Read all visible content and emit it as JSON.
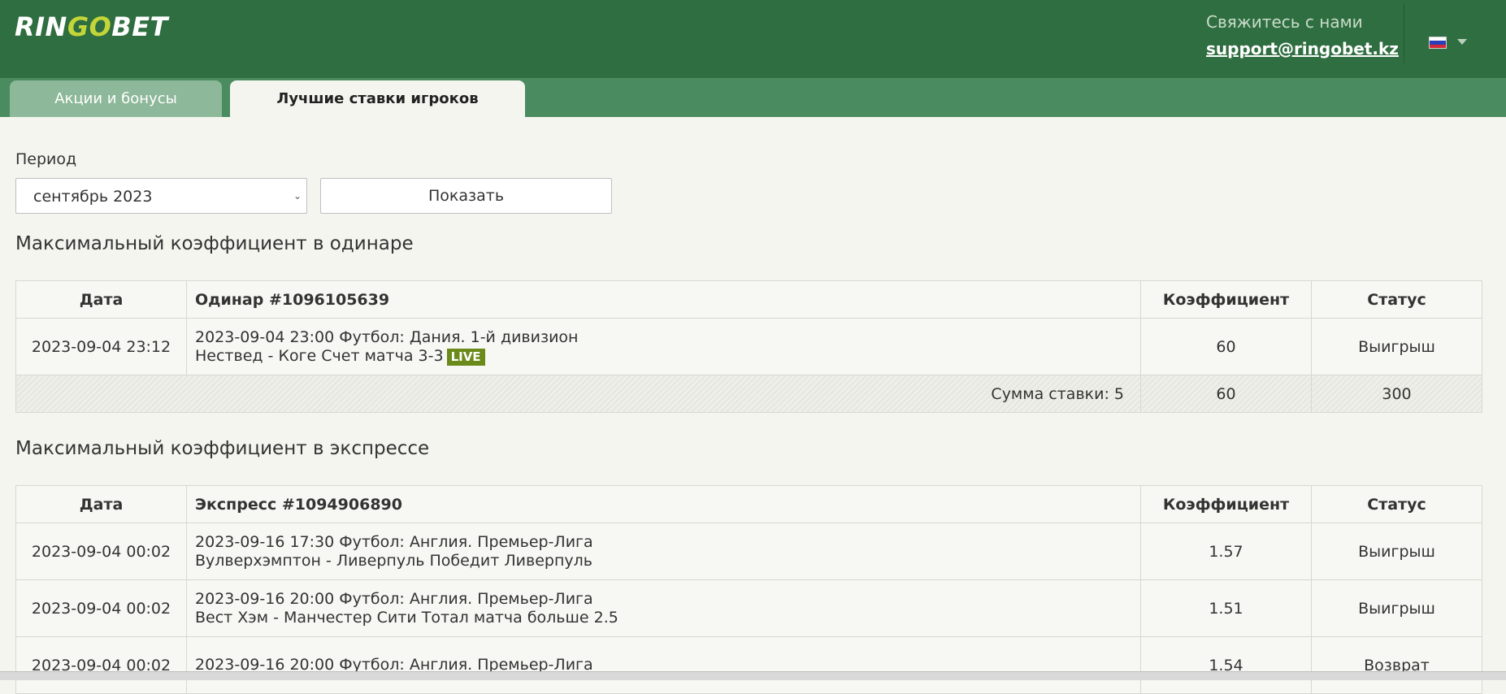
{
  "header": {
    "logo": {
      "part1": "RIN",
      "part2": "GO",
      "part3": "BET"
    },
    "contact_title": "Свяжитесь с нами",
    "contact_email": "support@ringobet.kz",
    "language_flag": "russia-flag-icon"
  },
  "tabs": [
    {
      "label": "Акции и бонусы",
      "active": false
    },
    {
      "label": "Лучшие ставки игроков",
      "active": true
    }
  ],
  "filter": {
    "period_label": "Период",
    "period_value": "сентябрь 2023",
    "show_button": "Показать"
  },
  "single": {
    "title": "Максимальный коэффициент в одинаре",
    "headers": {
      "date": "Дата",
      "bet": "Одинар #1096105639",
      "coef": "Коэффициент",
      "status": "Статус"
    },
    "rows": [
      {
        "date": "2023-09-04 23:12",
        "line1": "2023-09-04 23:00 Футбол: Дания. 1-й дивизион",
        "line2": "Нествед - Коге Счет матча 3-3",
        "badge": "LIVE",
        "coef": "60",
        "status": "Выигрыш"
      }
    ],
    "summary": {
      "label": "Сумма ставки: 5",
      "coef": "60",
      "payout": "300"
    }
  },
  "express": {
    "title": "Максимальный коэффициент в экспрессе",
    "headers": {
      "date": "Дата",
      "bet": "Экспресс #1094906890",
      "coef": "Коэффициент",
      "status": "Статус"
    },
    "rows": [
      {
        "date": "2023-09-04 00:02",
        "line1": "2023-09-16 17:30 Футбол: Англия. Премьер-Лига",
        "line2": "Вулверхэмптон - Ливерпуль Победит Ливерпуль",
        "coef": "1.57",
        "status": "Выигрыш"
      },
      {
        "date": "2023-09-04 00:02",
        "line1": "2023-09-16 20:00 Футбол: Англия. Премьер-Лига",
        "line2": "Вест Хэм - Манчестер Сити Тотал матча больше 2.5",
        "coef": "1.51",
        "status": "Выигрыш"
      },
      {
        "date": "2023-09-04 00:02",
        "line1": "2023-09-16 20:00 Футбол: Англия. Премьер-Лига",
        "line2": "",
        "coef": "1.54",
        "status": "Возврат"
      }
    ]
  },
  "colors": {
    "header_bg": "#2f6e40",
    "tabbar_bg": "#4a8c5f",
    "status_color": "#e07b24",
    "coef_color": "#2f6e40"
  }
}
